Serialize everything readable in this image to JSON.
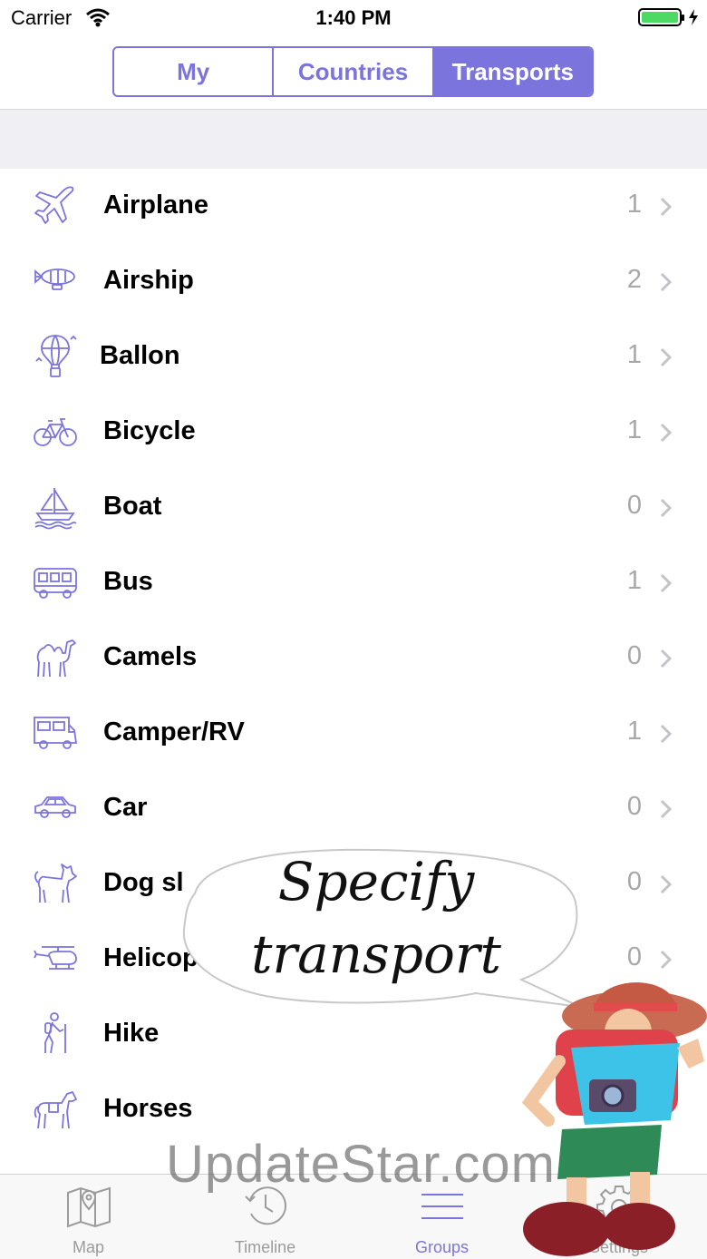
{
  "status_bar": {
    "carrier": "Carrier",
    "time": "1:40 PM"
  },
  "segments": [
    {
      "label": "My",
      "active": false
    },
    {
      "label": "Countries",
      "active": false
    },
    {
      "label": "Transports",
      "active": true
    }
  ],
  "transports": [
    {
      "icon": "airplane-icon",
      "label": "Airplane",
      "count": "1"
    },
    {
      "icon": "airship-icon",
      "label": "Airship",
      "count": "2"
    },
    {
      "icon": "balloon-icon",
      "label": "Ballon",
      "count": "1"
    },
    {
      "icon": "bicycle-icon",
      "label": "Bicycle",
      "count": "1"
    },
    {
      "icon": "boat-icon",
      "label": "Boat",
      "count": "0"
    },
    {
      "icon": "bus-icon",
      "label": "Bus",
      "count": "1"
    },
    {
      "icon": "camel-icon",
      "label": "Camels",
      "count": "0"
    },
    {
      "icon": "camper-icon",
      "label": "Camper/RV",
      "count": "1"
    },
    {
      "icon": "car-icon",
      "label": "Car",
      "count": "0"
    },
    {
      "icon": "dog-sled-icon",
      "label": "Dog sl",
      "count": "0"
    },
    {
      "icon": "helicopter-icon",
      "label": "Helicop",
      "count": "0"
    },
    {
      "icon": "hike-icon",
      "label": "Hike",
      "count": ""
    },
    {
      "icon": "horse-icon",
      "label": "Horses",
      "count": ""
    }
  ],
  "tabs": [
    {
      "icon": "map-icon",
      "label": "Map",
      "active": false
    },
    {
      "icon": "timeline-icon",
      "label": "Timeline",
      "active": false
    },
    {
      "icon": "groups-icon",
      "label": "Groups",
      "active": true
    },
    {
      "icon": "settings-icon",
      "label": "Settings",
      "active": false
    }
  ],
  "overlay": {
    "bubble_line1": "Specify",
    "bubble_line2": "transport",
    "watermark": "UpdateStar.com"
  },
  "colors": {
    "accent": "#7b74dd",
    "count_gray": "#a8a8ac",
    "section_gap": "#efeff4",
    "battery": "#4cd964"
  }
}
